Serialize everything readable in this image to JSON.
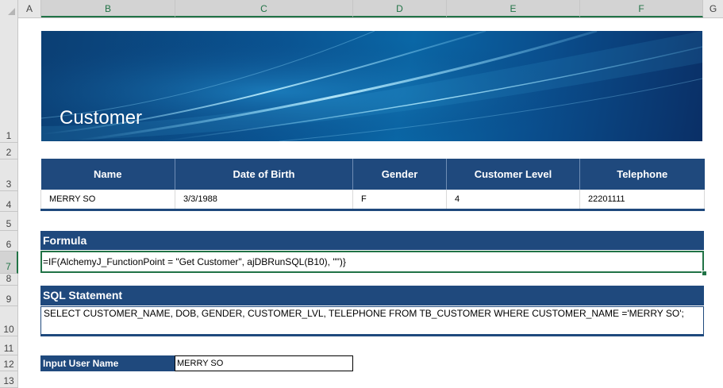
{
  "columns": [
    "A",
    "B",
    "C",
    "D",
    "E",
    "F",
    "G"
  ],
  "rows": [
    "1",
    "2",
    "3",
    "4",
    "5",
    "6",
    "7",
    "8",
    "9",
    "10",
    "11",
    "12",
    "13"
  ],
  "banner": {
    "title": "Customer"
  },
  "customer_table": {
    "headers": [
      "Name",
      "Date of Birth",
      "Gender",
      "Customer Level",
      "Telephone"
    ],
    "row": [
      "MERRY SO",
      "3/3/1988",
      "F",
      "4",
      "22201111"
    ]
  },
  "formula": {
    "header": "Formula",
    "value": "=IF(AlchemyJ_FunctionPoint = \"Get Customer\", ajDBRunSQL(B10), \"\")}"
  },
  "sql": {
    "header": "SQL Statement",
    "value": "SELECT CUSTOMER_NAME, DOB, GENDER, CUSTOMER_LVL, TELEPHONE FROM TB_CUSTOMER WHERE CUSTOMER_NAME ='MERRY SO';"
  },
  "input": {
    "label": "Input User Name",
    "value": "MERRY SO"
  },
  "colors": {
    "header_blue": "#1f497d",
    "selection_green": "#217346"
  }
}
